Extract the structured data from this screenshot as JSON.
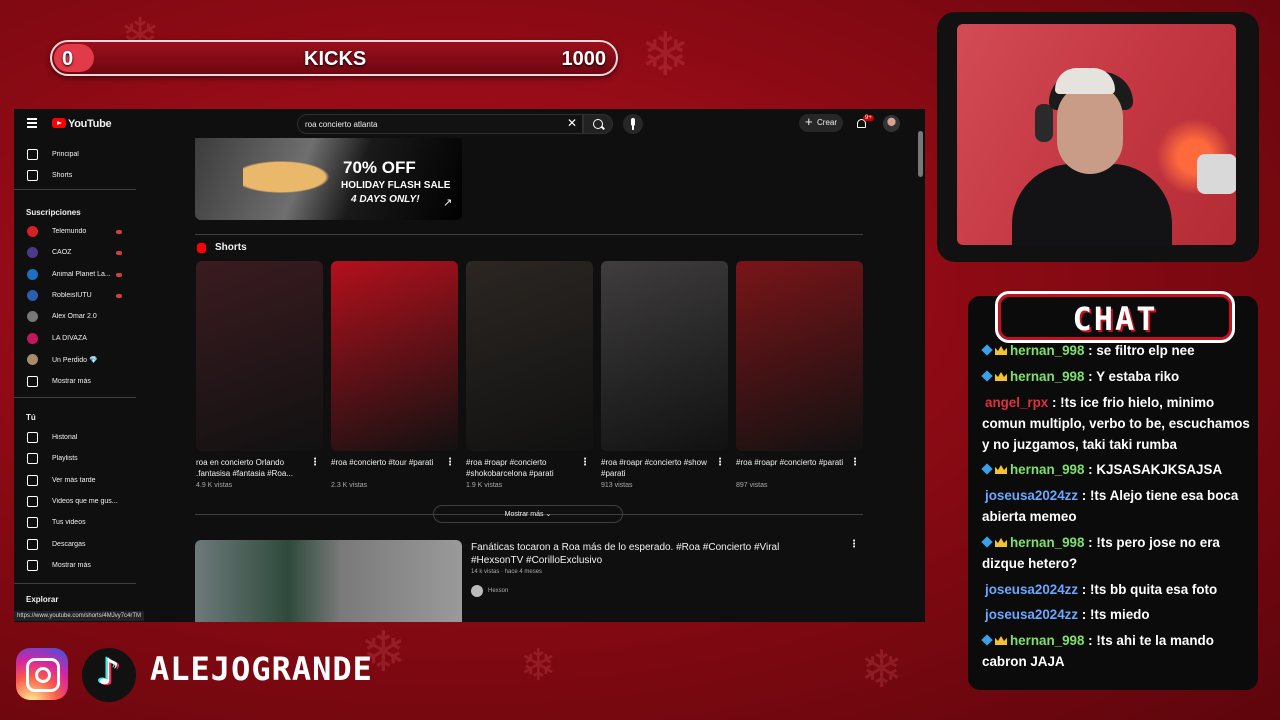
{
  "overlay": {
    "kicks": {
      "current": "0",
      "label": "KICKS",
      "goal": "1000",
      "progress_fraction": 0
    },
    "handle": "ALEJOGRANDE",
    "chat_title": "CHAT"
  },
  "youtube": {
    "brand": "YouTube",
    "search": {
      "value": "roa concierto atlanta"
    },
    "create_label": "Crear",
    "notifications_badge": "9+",
    "sidebar": {
      "main": [
        {
          "label": "Principal",
          "icon": "home-icon"
        },
        {
          "label": "Shorts",
          "icon": "shorts-icon"
        }
      ],
      "subscriptions_header": "Suscripciones",
      "subscriptions": [
        {
          "label": "Telemundo",
          "live": true,
          "color": "#d61f26"
        },
        {
          "label": "CAOZ",
          "live": true,
          "color": "#4b3a8a"
        },
        {
          "label": "Animal Planet La...",
          "live": true,
          "color": "#1e6fbf"
        },
        {
          "label": "RobleisIUTU",
          "live": true,
          "color": "#2a5db0"
        },
        {
          "label": "Alex Omar 2.0",
          "live": false,
          "color": "#777777"
        },
        {
          "label": "LA DIVAZA",
          "live": false,
          "color": "#c2185b"
        },
        {
          "label": "Un Perdido 💎",
          "live": false,
          "color": "#a88b6a"
        }
      ],
      "show_more_1": "Mostrar más",
      "you_header": "Tú",
      "you_items": [
        {
          "label": "Historial",
          "icon": "history-icon"
        },
        {
          "label": "Playlists",
          "icon": "playlist-icon"
        },
        {
          "label": "Ver más tarde",
          "icon": "clock-icon"
        },
        {
          "label": "Videos que me gus...",
          "icon": "thumbs-up-icon"
        },
        {
          "label": "Tus videos",
          "icon": "video-icon"
        },
        {
          "label": "Descargas",
          "icon": "download-icon"
        }
      ],
      "show_more_2": "Mostrar más",
      "explore_header": "Explorar"
    },
    "ad": {
      "headline": "70% OFF",
      "subline": "HOLIDAY FLASH SALE",
      "tagline": "4 DAYS ONLY!"
    },
    "shorts_header": "Shorts",
    "shorts": [
      {
        "title": "roa en concierto Orlando .fantasisa #fantasia  #Roa...",
        "views": "4.9 K vistas",
        "tint": "#3a1b20"
      },
      {
        "title": "#roa #concierto #tour #parati",
        "views": "2.3 K vistas",
        "tint": "#b3101c"
      },
      {
        "title": "#roa #roapr #concierto #shokobarcelona #parati",
        "views": "1.9 K vistas",
        "tint": "#2b2622"
      },
      {
        "title": "#roa #roapr #concierto #show #parati",
        "views": "913 vistas",
        "tint": "#3f3d3d"
      },
      {
        "title": "#roa #roapr #concierto #parati",
        "views": "897 vistas",
        "tint": "#7a1418"
      }
    ],
    "shorts_show_more": "Mostrar más",
    "video": {
      "title": "Fanáticas tocaron a Roa más de lo esperado. #Roa #Concierto #Viral #HexsonTV #CorilloExclusivo",
      "meta": "14 k vistas · hace 4 meses",
      "channel": "Hexson"
    },
    "status_url": "https://www.youtube.com/shorts/4MJvy7c4rTM"
  },
  "chat": [
    {
      "user": "hernan_998",
      "color": "#7ee06a",
      "badges": true,
      "text": ": se filtro elp nee"
    },
    {
      "user": "hernan_998",
      "color": "#7ee06a",
      "badges": true,
      "text": ": Y estaba riko"
    },
    {
      "user": "angel_rpx",
      "color": "#e0303c",
      "badges": false,
      "text": ": !ts ice frio hielo, minimo comun multiplo, verbo to be, escuchamos y no juzgamos, taki taki rumba"
    },
    {
      "user": "hernan_998",
      "color": "#7ee06a",
      "badges": true,
      "text": ": KJSASAKJKSAJSA"
    },
    {
      "user": "joseusa2024zz",
      "color": "#6ba6ff",
      "badges": false,
      "text": ": !ts Alejo tiene esa boca abierta memeo"
    },
    {
      "user": "hernan_998",
      "color": "#7ee06a",
      "badges": true,
      "text": ": !ts pero jose no era dizque hetero?"
    },
    {
      "user": "joseusa2024zz",
      "color": "#6ba6ff",
      "badges": false,
      "text": ": !ts bb quita esa foto"
    },
    {
      "user": "joseusa2024zz",
      "color": "#6ba6ff",
      "badges": false,
      "text": ": !ts miedo"
    },
    {
      "user": "hernan_998",
      "color": "#7ee06a",
      "badges": true,
      "text": ": !ts ahi te la mando cabron JAJA"
    }
  ]
}
